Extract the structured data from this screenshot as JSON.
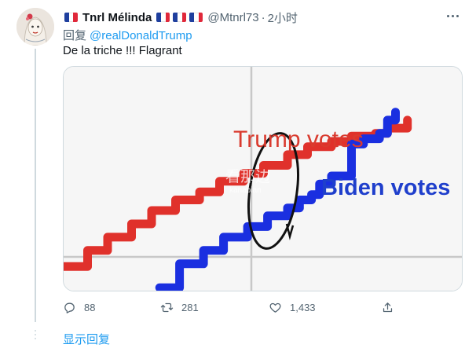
{
  "tweet": {
    "author": {
      "display_name": "Tnrl Mélinda",
      "handle": "@Mtnrl73",
      "name_flags_before": 1,
      "name_flags_after": 3
    },
    "separator": "·",
    "time": "2小时",
    "reply_prefix": "回复",
    "reply_to": "@realDonaldTrump",
    "text": "De la triche !!! Flagrant",
    "media": {
      "label_trump": "Trump votes",
      "label_biden": "Biden votes",
      "watermark_line1": "看那边",
      "watermark_line2": "kanabian"
    },
    "stats": {
      "replies": "88",
      "retweets": "281",
      "likes": "1,433"
    },
    "show_replies": "显示回复"
  },
  "colors": {
    "accent": "#1d9bf0",
    "trump_line": "#e0312b",
    "biden_line": "#1a2fe0",
    "flag_blue": "#1f3f9e",
    "flag_red": "#e0283a"
  },
  "chart_data": {
    "type": "line",
    "series": [
      {
        "name": "Trump votes",
        "x": [
          0,
          6,
          11,
          17,
          22,
          28,
          34,
          39,
          45,
          50,
          56,
          61,
          67,
          72,
          78,
          81,
          86
        ],
        "y": [
          8,
          14,
          19,
          24,
          29,
          33,
          36,
          40,
          43,
          46,
          50,
          53,
          55,
          57,
          58,
          60,
          63
        ]
      },
      {
        "name": "Biden votes",
        "x": [
          24,
          29,
          35,
          40,
          46,
          51,
          56,
          59,
          62,
          64,
          67,
          72,
          75,
          79,
          81,
          83
        ],
        "y": [
          0,
          9,
          14,
          19,
          23,
          27,
          30,
          33,
          35,
          39,
          42,
          54,
          56,
          58,
          63,
          66
        ]
      }
    ],
    "grid": true,
    "annotation": "hand-drawn circle around the vertical jump in Biden votes"
  }
}
